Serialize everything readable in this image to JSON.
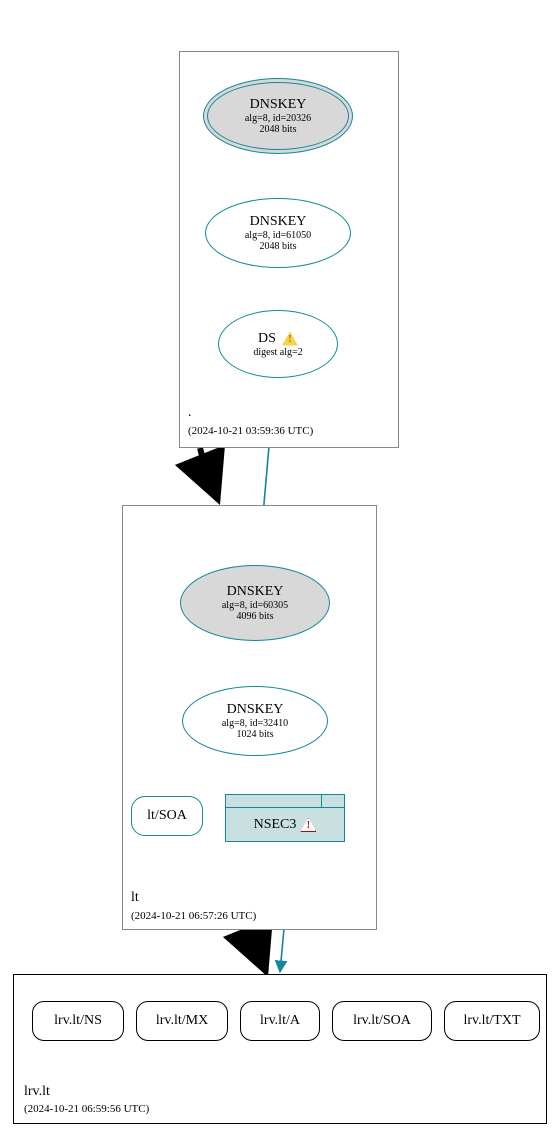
{
  "zones": [
    {
      "name": ".",
      "timestamp": "(2024-10-21 03:59:36 UTC)"
    },
    {
      "name": "lt",
      "timestamp": "(2024-10-21 06:57:26 UTC)"
    },
    {
      "name": "lrv.lt",
      "timestamp": "(2024-10-21 06:59:56 UTC)"
    }
  ],
  "nodes": {
    "root_ksk": {
      "title": "DNSKEY",
      "line1": "alg=8, id=20326",
      "line2": "2048 bits"
    },
    "root_zsk": {
      "title": "DNSKEY",
      "line1": "alg=8, id=61050",
      "line2": "2048 bits"
    },
    "root_ds": {
      "title": "DS",
      "line1": "digest alg=2"
    },
    "lt_ksk": {
      "title": "DNSKEY",
      "line1": "alg=8, id=60305",
      "line2": "4096 bits"
    },
    "lt_zsk": {
      "title": "DNSKEY",
      "line1": "alg=8, id=32410",
      "line2": "1024 bits"
    },
    "lt_soa": {
      "label": "lt/SOA"
    },
    "lt_nsec3": {
      "label": "NSEC3"
    },
    "lrv_ns": {
      "label": "lrv.lt/NS"
    },
    "lrv_mx": {
      "label": "lrv.lt/MX"
    },
    "lrv_a": {
      "label": "lrv.lt/A"
    },
    "lrv_soa": {
      "label": "lrv.lt/SOA"
    },
    "lrv_txt": {
      "label": "lrv.lt/TXT"
    }
  },
  "colors": {
    "teal": "#118899"
  }
}
